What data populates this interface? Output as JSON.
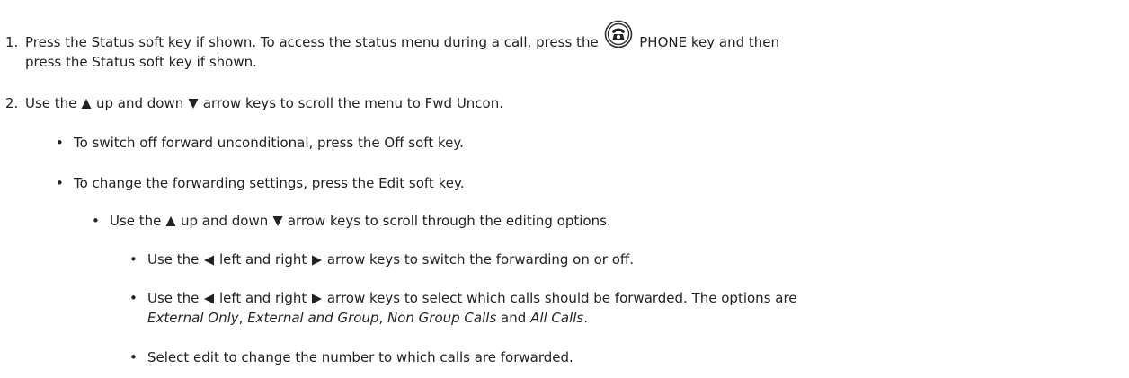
{
  "steps": [
    {
      "num": "1.",
      "text_a": "Press the Status soft key if shown. To access the status menu during a call, press the",
      "key_label": "PHONE key and then",
      "text_b": "press the Status soft key if shown."
    },
    {
      "num": "2.",
      "text_a": "Use the",
      "up_word": "up and down",
      "text_b": "arrow keys to scroll the menu to Fwd Uncon."
    }
  ],
  "bullets_l1": [
    "To switch off forward unconditional, press the Off soft key.",
    "To change the forwarding settings, press the Edit soft key."
  ],
  "bullet_l2": {
    "text_a": "Use the",
    "up_word": "up and down",
    "text_b": "arrow keys to scroll through the editing options."
  },
  "bullets_l3": {
    "item1": {
      "text_a": "Use the",
      "mid": "left and right",
      "text_b": "arrow keys to switch the forwarding on or off."
    },
    "item2": {
      "text_a": "Use the",
      "mid": "left and right",
      "text_b": "arrow keys to select which calls should be forwarded. The options are",
      "opt1": "External Only",
      "sep1": ",",
      "opt2": "External and Group",
      "sep2": ",",
      "opt3": "Non Group Calls",
      "and": "and",
      "opt4": "All Calls",
      "end": "."
    },
    "item3": "Select edit to change the number to which calls are forwarded."
  },
  "bullet_char": "•",
  "icons": {
    "phone_key": "phone-key-icon",
    "up": "up-arrow-icon",
    "down": "down-arrow-icon",
    "left": "left-arrow-icon",
    "right": "right-arrow-icon"
  }
}
